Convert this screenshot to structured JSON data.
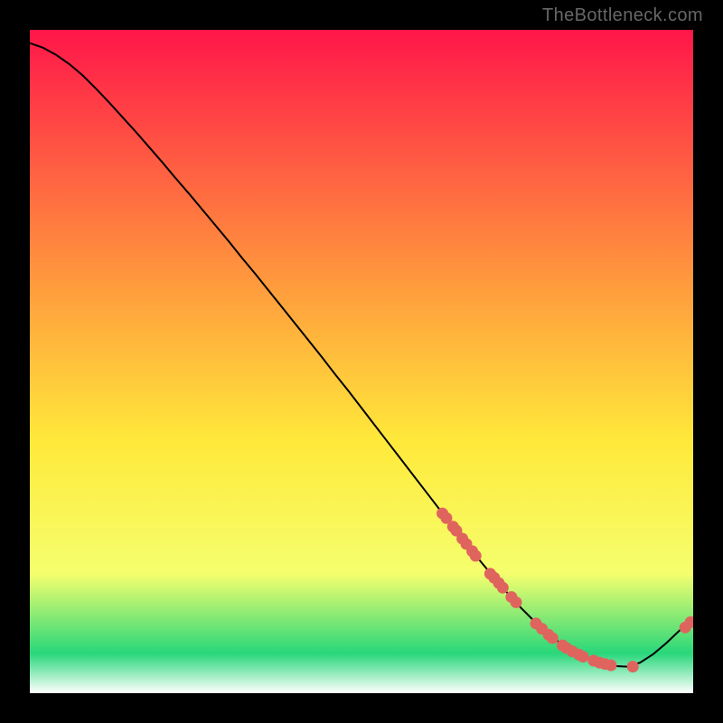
{
  "watermark": "TheBottleneck.com",
  "chart_data": {
    "type": "line",
    "title": "",
    "xlabel": "",
    "ylabel": "",
    "xlim": [
      0,
      100
    ],
    "ylim": [
      0,
      100
    ],
    "grid": false,
    "curve": {
      "comment": "Black curve: y-values (0–100) sampled at x = 0..100 in steps of 2. Starts ~98, descends roughly linearly to a trough near x≈90 (y≈4), then rises back toward ~11.",
      "x": [
        0,
        2,
        4,
        6,
        8,
        10,
        12,
        14,
        16,
        18,
        20,
        22,
        24,
        26,
        28,
        30,
        32,
        34,
        36,
        38,
        40,
        42,
        44,
        46,
        48,
        50,
        52,
        54,
        56,
        58,
        60,
        62,
        64,
        66,
        68,
        70,
        72,
        74,
        76,
        78,
        80,
        82,
        84,
        86,
        88,
        90,
        92,
        94,
        96,
        98,
        100
      ],
      "y": [
        98.0,
        97.3,
        96.2,
        94.8,
        93.1,
        91.1,
        89.0,
        86.8,
        84.6,
        82.3,
        80.0,
        77.6,
        75.3,
        72.9,
        70.5,
        68.1,
        65.6,
        63.2,
        60.7,
        58.2,
        55.7,
        53.2,
        50.7,
        48.1,
        45.6,
        43.0,
        40.4,
        37.8,
        35.2,
        32.6,
        30.0,
        27.4,
        24.8,
        22.3,
        19.8,
        17.4,
        15.1,
        12.9,
        10.9,
        9.1,
        7.5,
        6.2,
        5.2,
        4.5,
        4.1,
        4.0,
        4.6,
        5.9,
        7.6,
        9.5,
        11.0
      ]
    },
    "dots": {
      "comment": "Salmon dots lying on the curve (approximate x positions, y taken from curve)",
      "x": [
        62.2,
        62.8,
        63.8,
        64.3,
        65.2,
        65.8,
        66.7,
        67.2,
        69.4,
        70.0,
        70.7,
        71.3,
        72.6,
        73.3,
        76.3,
        77.2,
        78.2,
        78.8,
        80.3,
        80.9,
        81.8,
        82.8,
        83.4,
        85.0,
        85.9,
        86.7,
        87.6,
        90.9,
        98.8,
        99.6
      ],
      "y": [
        27.1,
        26.4,
        25.1,
        24.5,
        23.3,
        22.5,
        21.4,
        20.7,
        18.0,
        17.4,
        16.6,
        15.9,
        14.5,
        13.7,
        10.5,
        9.7,
        8.8,
        8.3,
        7.2,
        6.8,
        6.3,
        5.8,
        5.5,
        4.9,
        4.6,
        4.4,
        4.2,
        4.0,
        9.9,
        10.7
      ]
    },
    "colors": {
      "curve": "#000000",
      "dots": "#e0645e",
      "gradient_top": "#ff1649",
      "gradient_mid1": "#ff8c3e",
      "gradient_mid2": "#ffe93a",
      "gradient_low": "#f5ff6e",
      "gradient_green": "#28d77a",
      "gradient_bottom": "#ffffff"
    }
  }
}
